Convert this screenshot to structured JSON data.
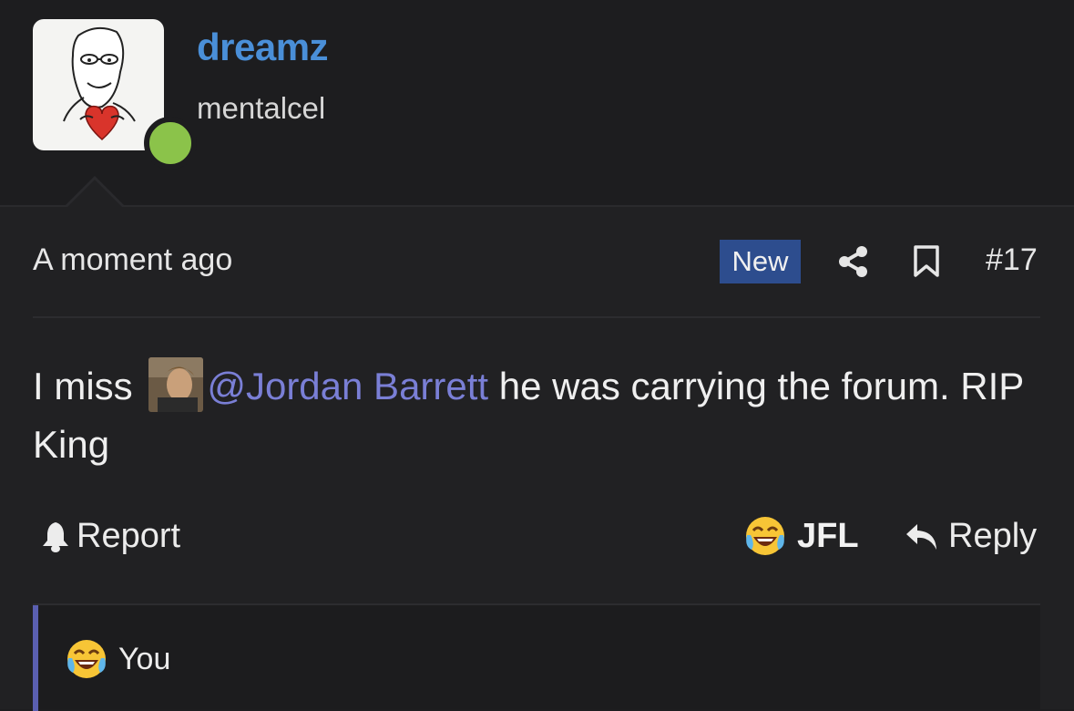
{
  "post": {
    "author": {
      "username": "dreamz",
      "user_title": "mentalcel",
      "online": true
    },
    "timestamp": "A moment ago",
    "badge": "New",
    "post_number": "#17",
    "message": {
      "before": "I miss",
      "mention": "@Jordan Barrett",
      "after": " he was carrying the forum. RIP King"
    }
  },
  "actions": {
    "report_label": "Report",
    "reaction_label": "JFL",
    "reply_label": "Reply"
  },
  "reactions": {
    "summary": "You"
  },
  "colors": {
    "background": "#1d1d1f",
    "username": "#4a8fd8",
    "mention": "#7a7fd6",
    "badge": "#2d4d8e",
    "online": "#8bc34a",
    "reaction_bar": "#5a5fb0"
  },
  "icons": [
    "share-icon",
    "bookmark-icon",
    "bell-icon",
    "laughing-crying-emoji-icon",
    "reply-arrow-icon"
  ]
}
